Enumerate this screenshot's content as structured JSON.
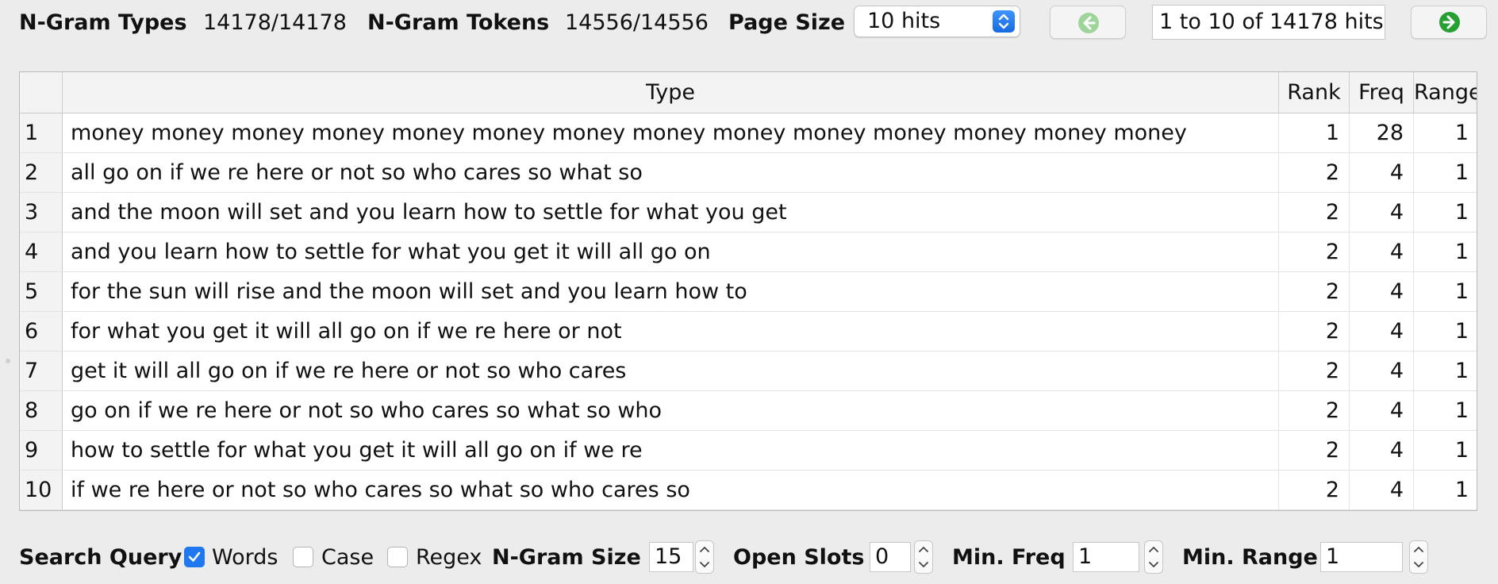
{
  "stats": {
    "ngram_types_label": "N-Gram Types",
    "ngram_types_value": "14178/14178",
    "ngram_tokens_label": "N-Gram Tokens",
    "ngram_tokens_value": "14556/14556"
  },
  "page_size": {
    "label": "Page Size",
    "selected": "10 hits"
  },
  "navigation": {
    "prev_icon": "back-arrow-icon",
    "next_icon": "forward-arrow-icon",
    "hits_text": "1 to 10 of 14178 hits"
  },
  "table": {
    "columns": [
      "Type",
      "Rank",
      "Freq",
      "Range"
    ],
    "rows": [
      {
        "index": "1",
        "type": "money money money money money money money money money money money money money money",
        "rank": "1",
        "freq": "28",
        "range": "1"
      },
      {
        "index": "2",
        "type": "all go on if we re here or not so who cares so what so",
        "rank": "2",
        "freq": "4",
        "range": "1"
      },
      {
        "index": "3",
        "type": "and the moon will set and you learn how to settle for what you get",
        "rank": "2",
        "freq": "4",
        "range": "1"
      },
      {
        "index": "4",
        "type": "and you learn how to settle for what you get it will all go on",
        "rank": "2",
        "freq": "4",
        "range": "1"
      },
      {
        "index": "5",
        "type": "for the sun will rise and the moon will set and you learn how to",
        "rank": "2",
        "freq": "4",
        "range": "1"
      },
      {
        "index": "6",
        "type": "for what you get it will all go on if we re here or not",
        "rank": "2",
        "freq": "4",
        "range": "1"
      },
      {
        "index": "7",
        "type": "get it will all go on if we re here or not so who cares",
        "rank": "2",
        "freq": "4",
        "range": "1"
      },
      {
        "index": "8",
        "type": "go on if we re here or not so who cares so what so who",
        "rank": "2",
        "freq": "4",
        "range": "1"
      },
      {
        "index": "9",
        "type": "how to settle for what you get it will all go on if we re",
        "rank": "2",
        "freq": "4",
        "range": "1"
      },
      {
        "index": "10",
        "type": "if we re here or not so who cares so what so who cares so",
        "rank": "2",
        "freq": "4",
        "range": "1"
      }
    ]
  },
  "search": {
    "label": "Search Query",
    "words_label": "Words",
    "words_checked": true,
    "case_label": "Case",
    "case_checked": false,
    "regex_label": "Regex",
    "regex_checked": false,
    "ngram_size_label": "N-Gram Size",
    "ngram_size_value": "15",
    "open_slots_label": "Open Slots",
    "open_slots_value": "0",
    "min_freq_label": "Min. Freq",
    "min_freq_value": "1",
    "min_range_label": "Min. Range",
    "min_range_value": "1"
  },
  "colors": {
    "accent": "#1f78f0",
    "nav_icon_disabled": "#9fd59a",
    "nav_icon_enabled": "#27a033",
    "background": "#ececec"
  }
}
